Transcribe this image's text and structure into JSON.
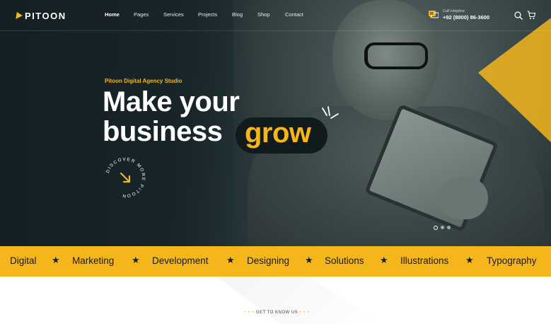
{
  "brand": {
    "name": "PITOON",
    "accent": "#f5b61c"
  },
  "nav": {
    "items": [
      {
        "label": "Home"
      },
      {
        "label": "Pages"
      },
      {
        "label": "Services"
      },
      {
        "label": "Projects"
      },
      {
        "label": "Blog"
      },
      {
        "label": "Shop"
      },
      {
        "label": "Contact"
      }
    ]
  },
  "helpline": {
    "label": "Call Helpline",
    "number": "+92 (8800) 86-3600"
  },
  "hero": {
    "tagline": "Pitoon Digital Agency Studio",
    "line1": "Make your",
    "line2": "business",
    "highlight": "grow",
    "badge_text": "DISCOVER MORE PITOON",
    "slider": {
      "total": 3,
      "active": 1
    }
  },
  "marquee": {
    "items": [
      "Digital",
      "Marketing",
      "Development",
      "Designing",
      "Solutions",
      "Illustrations",
      "Typography"
    ],
    "separator": "★"
  },
  "about": {
    "eyebrow": "GET TO KNOW US",
    "eyebrow_dots": "• • •"
  }
}
